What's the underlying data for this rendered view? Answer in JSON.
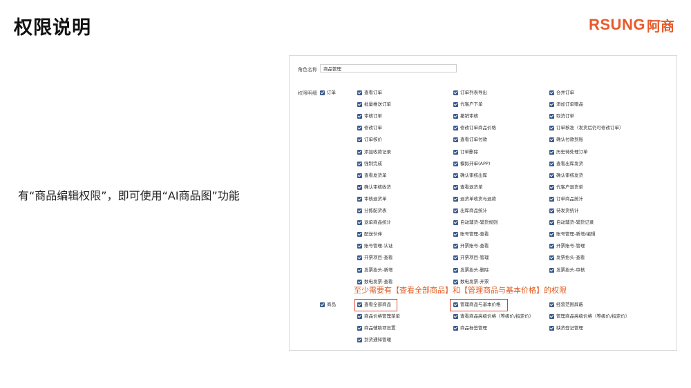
{
  "slide": {
    "title": "权限说明",
    "logo_text": "RSUNG",
    "logo_cn": "阿商",
    "note": "有“商品编辑权限”，即可使用“AI商品图”功能",
    "callout": "至少需要有【查看全部商品】和【管理商品与基本价格】的权限"
  },
  "form": {
    "role_label": "角色名称",
    "role_value": "商品管理",
    "perm_label": "权限明细",
    "order_group": "订单",
    "order_items": [
      "查看订单",
      "订单列表导出",
      "合并订单",
      "批量推送订单",
      "代客户下单",
      "添加订单赠品",
      "审核订单",
      "撤销审核",
      "取消订单",
      "修改订单",
      "修改订单商品价格",
      "订单核准（发货后仍可修改订单）",
      "订单核价",
      "查看订单付款",
      "确认付款到账",
      "添加收款记录",
      "订单删除",
      "历史待处理订单",
      "强制完成",
      "模拟开单(APP)",
      "查看出库发货",
      "查看发货单",
      "确认审核出库",
      "确认审核发货",
      "确认审核收货",
      "查看退货单",
      "代客户退货单",
      "审核退货单",
      "退货单收货与退款",
      "订单商品统计",
      "分拣配货表",
      "出库商品统计",
      "待发货统计",
      "退单商品统计",
      "自动辅货-辅货规则",
      "自动辅货-辅货记录",
      "配送伙伴",
      "账号管理-查看",
      "账号管理-新增/编辑",
      "账号管理-认证",
      "开票账号-查看",
      "开票账号-管理",
      "开票项目-查看",
      "开票项目-管理",
      "发票抬头-查看",
      "发票抬头-新增",
      "发票抬头-删除",
      "发票抬头-审核",
      "数电发票-查看",
      "数电发票-开票"
    ],
    "goods_group": "商品",
    "goods_items": [
      "查看全部商品",
      "管理商品与基本价格",
      "经营范围屏蔽",
      "商品价格管理菜单",
      "查看商品高级价格（等级价/指定价）",
      "管理商品高级价格（等级价/指定价）",
      "商品辅助项设置",
      "商品标签管理",
      "缺货登记管理",
      "到货通知管理"
    ]
  }
}
